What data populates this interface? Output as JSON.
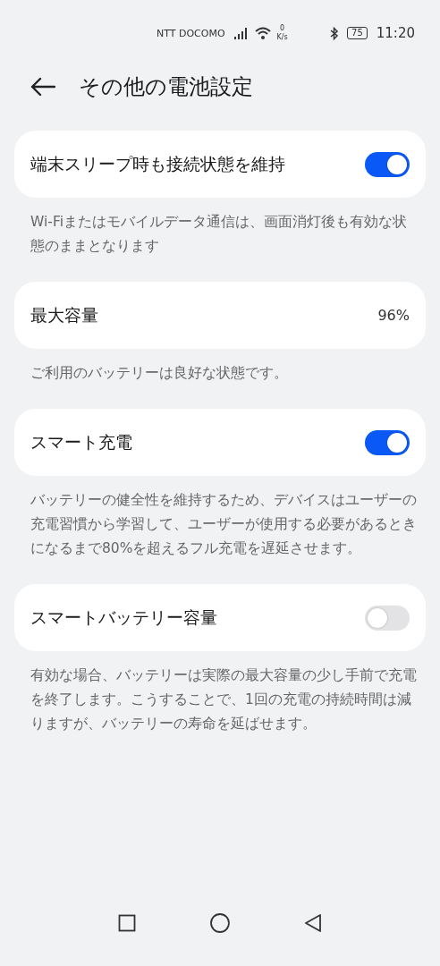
{
  "status_bar": {
    "carrier": "NTT DOCOMO",
    "speed_value": "0",
    "speed_unit": "K/s",
    "battery": "75",
    "time": "11:20"
  },
  "header": {
    "title": "その他の電池設定"
  },
  "settings": [
    {
      "kind": "switch",
      "label": "端末スリープ時も接続状態を維持",
      "on": true,
      "description": "Wi-Fiまたはモバイルデータ通信は、画面消灯後も有効な状態のままとなります"
    },
    {
      "kind": "value",
      "label": "最大容量",
      "value": "96%",
      "description": "ご利用のバッテリーは良好な状態です。"
    },
    {
      "kind": "switch",
      "label": "スマート充電",
      "on": true,
      "description": "バッテリーの健全性を維持するため、デバイスはユーザーの充電習慣から学習して、ユーザーが使用する必要があるときになるまで80%を超えるフル充電を遅延させます。"
    },
    {
      "kind": "switch",
      "label": "スマートバッテリー容量",
      "on": false,
      "description": "有効な場合、バッテリーは実際の最大容量の少し手前で充電を終了します。こうすることで、1回の充電の持続時間は減りますが、バッテリーの寿命を延ばせます。"
    }
  ]
}
